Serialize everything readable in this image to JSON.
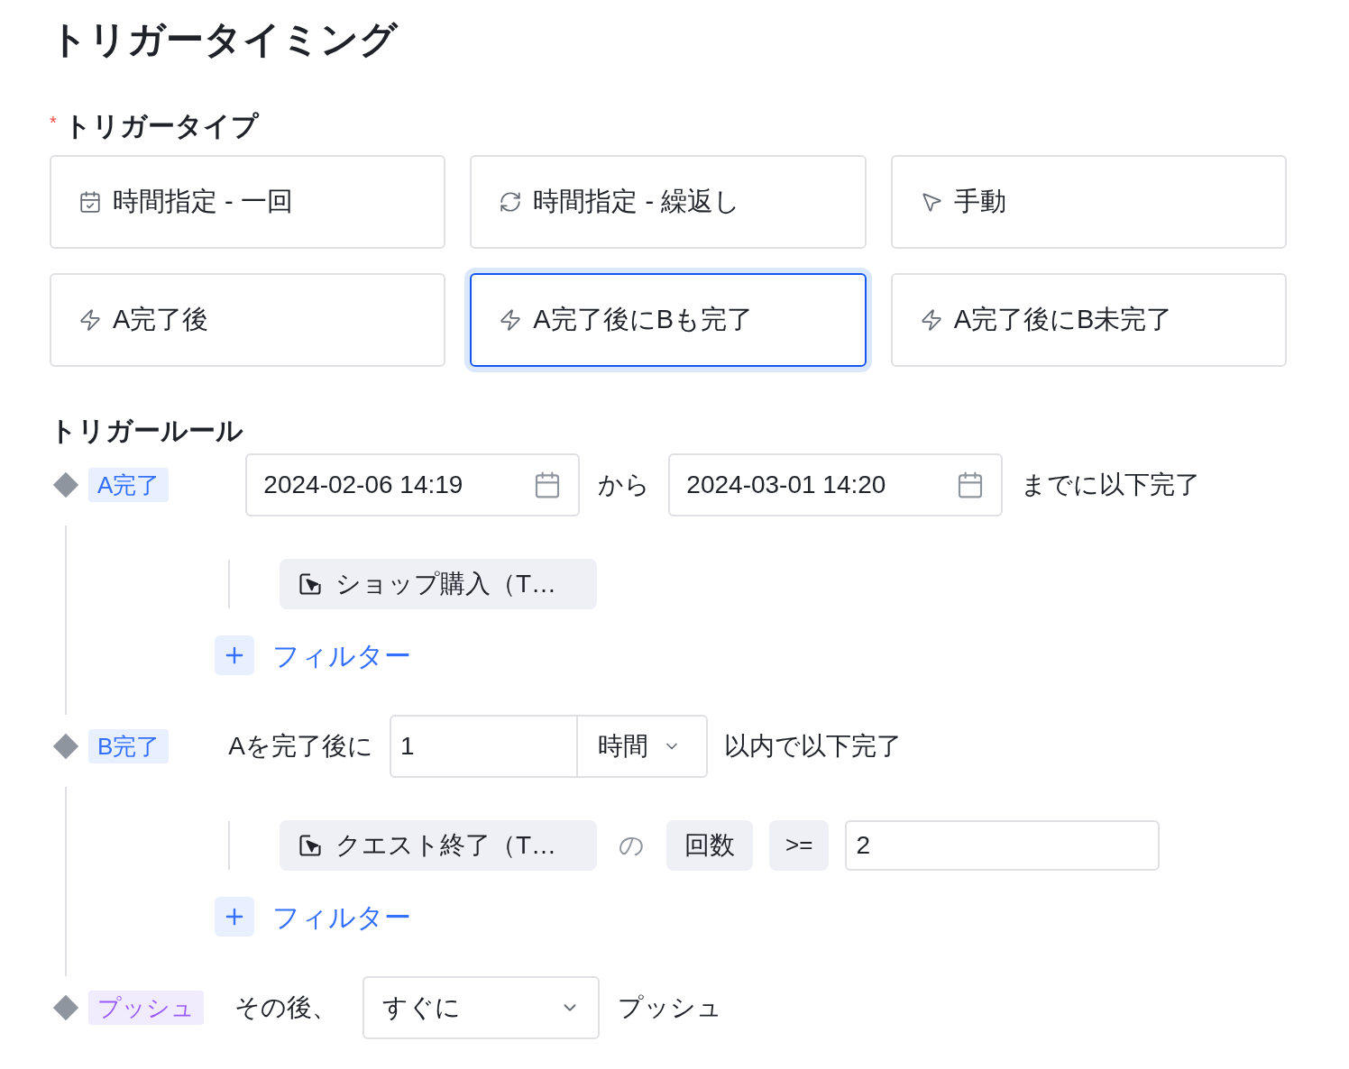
{
  "title": "トリガータイミング",
  "trigger_type": {
    "label": "トリガータイプ",
    "required_mark": "*",
    "options": [
      {
        "kind": "once",
        "label": "時間指定 - 一回",
        "selected": false
      },
      {
        "kind": "repeat",
        "label": "時間指定 - 繰返し",
        "selected": false
      },
      {
        "kind": "manual",
        "label": "手動",
        "selected": false
      },
      {
        "kind": "event",
        "label": "A完了後",
        "selected": false
      },
      {
        "kind": "event",
        "label": "A完了後にBも完了",
        "selected": true
      },
      {
        "kind": "event",
        "label": "A完了後にB未完了",
        "selected": false
      }
    ]
  },
  "trigger_rule": {
    "label": "トリガールール",
    "steps": [
      {
        "kind": "date_range",
        "tag": "A完了",
        "color": "#3370ff",
        "start": "2024-02-06 14:19",
        "connector": "から",
        "end": "2024-03-01 14:20",
        "suffix": "までに以下完了",
        "events": [
          {
            "name": "ショップ購入（T…"
          }
        ],
        "filter": "フィルター"
      },
      {
        "kind": "within",
        "tag": "B完了",
        "color": "#3370ff",
        "prefix": "Aを完了後に",
        "amount": "1",
        "unit": "時間",
        "suffix": "以内で以下完了",
        "events": [
          {
            "name": "クエスト終了（T…",
            "connector": "の",
            "metric": "回数",
            "operator": ">=",
            "value": "2"
          }
        ],
        "filter": "フィルター"
      },
      {
        "kind": "push",
        "tag": "プッシュ",
        "color": "#9b5cf6",
        "prefix": "その後、",
        "timing": "すぐに",
        "suffix": "プッシュ"
      }
    ]
  }
}
